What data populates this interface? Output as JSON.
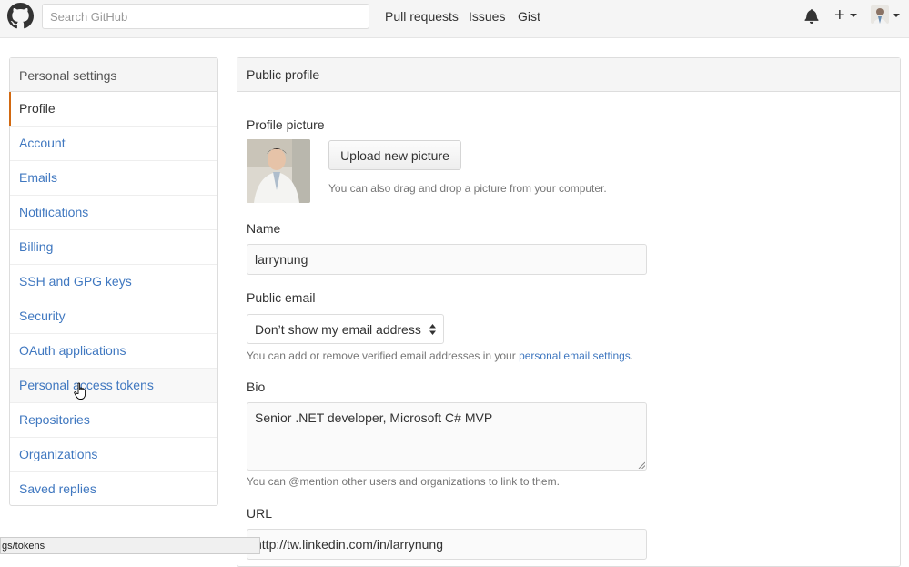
{
  "header": {
    "search_placeholder": "Search GitHub",
    "nav": [
      "Pull requests",
      "Issues",
      "Gist"
    ],
    "plus_symbol": "+",
    "icons": [
      "github-logo-icon",
      "bell-icon",
      "plus-icon",
      "avatar"
    ]
  },
  "sidebar": {
    "title": "Personal settings",
    "items": [
      "Profile",
      "Account",
      "Emails",
      "Notifications",
      "Billing",
      "SSH and GPG keys",
      "Security",
      "OAuth applications",
      "Personal access tokens",
      "Repositories",
      "Organizations",
      "Saved replies"
    ],
    "selected": "Profile"
  },
  "profile": {
    "panel_title": "Public profile",
    "picture_label": "Profile picture",
    "upload_button": "Upload new picture",
    "upload_note": "You can also drag and drop a picture from your computer.",
    "name_label": "Name",
    "name_value": "larrynung",
    "email_label": "Public email",
    "email_selected": "Don’t show my email address",
    "email_note_prefix": "You can add or remove verified email addresses in your ",
    "email_note_link": "personal email settings",
    "email_note_suffix": ".",
    "bio_label": "Bio",
    "bio_value": "Senior .NET developer, Microsoft C# MVP",
    "bio_note": "You can @mention other users and organizations to link to them.",
    "url_label": "URL",
    "url_value": "http://tw.linkedin.com/in/larrynung"
  },
  "status_bar": {
    "text": "gs/tokens"
  },
  "colors": {
    "link": "#4078c0",
    "selected_marker": "#d26911",
    "header_bg": "#f5f5f5"
  }
}
